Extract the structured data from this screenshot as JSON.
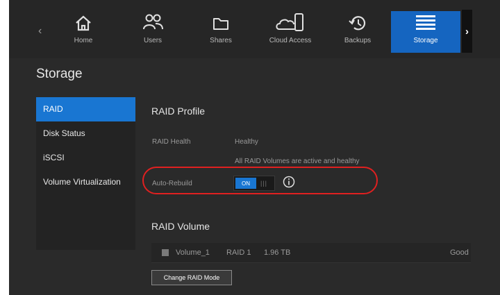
{
  "nav": {
    "items": [
      {
        "label": "Home",
        "icon": "home-icon"
      },
      {
        "label": "Users",
        "icon": "users-icon"
      },
      {
        "label": "Shares",
        "icon": "folder-icon"
      },
      {
        "label": "Cloud Access",
        "icon": "cloud-device-icon"
      },
      {
        "label": "Backups",
        "icon": "backup-history-icon"
      },
      {
        "label": "Storage",
        "icon": "storage-list-icon",
        "active": true
      }
    ]
  },
  "page": {
    "title": "Storage"
  },
  "sidebar": {
    "items": [
      {
        "label": "RAID",
        "active": true
      },
      {
        "label": "Disk Status"
      },
      {
        "label": "iSCSI"
      },
      {
        "label": "Volume Virtualization"
      }
    ]
  },
  "raid_profile": {
    "title": "RAID Profile",
    "health_label": "RAID Health",
    "health_value": "Healthy",
    "health_detail": "All RAID Volumes are active and healthy",
    "auto_rebuild_label": "Auto-Rebuild",
    "auto_rebuild_state": "ON"
  },
  "raid_volume": {
    "title": "RAID Volume",
    "rows": [
      {
        "name": "Volume_1",
        "raid": "RAID 1",
        "size": "1.96 TB",
        "status": "Good"
      }
    ]
  },
  "buttons": {
    "change_raid_mode": "Change RAID Mode"
  },
  "colors": {
    "accent": "#1976d2",
    "highlight": "#e02020",
    "background": "#2a2a2a"
  }
}
